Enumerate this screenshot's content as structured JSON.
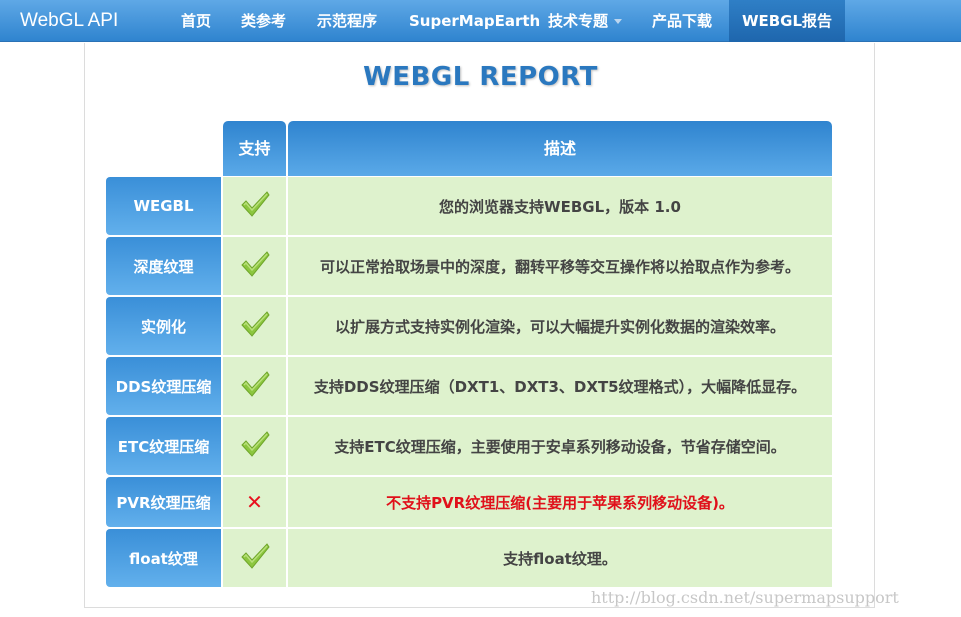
{
  "navbar": {
    "brand": "WebGL API",
    "items": [
      {
        "label": "首页"
      },
      {
        "label": "类参考"
      },
      {
        "label": "示范程序"
      },
      {
        "label": "SuperMapEarth"
      },
      {
        "label": "技术专题"
      },
      {
        "label": "产品下载"
      },
      {
        "label": "WEBGL报告"
      }
    ]
  },
  "title": "WEBGL REPORT",
  "table": {
    "headers": {
      "support": "支持",
      "description": "描述"
    },
    "rows": [
      {
        "feature": "WEGBL",
        "supported": true,
        "description": "您的浏览器支持WEBGL，版本 1.0"
      },
      {
        "feature": "深度纹理",
        "supported": true,
        "description": "可以正常拾取场景中的深度，翻转平移等交互操作将以拾取点作为参考。"
      },
      {
        "feature": "实例化",
        "supported": true,
        "description": "以扩展方式支持实例化渲染，可以大幅提升实例化数据的渲染效率。"
      },
      {
        "feature": "DDS纹理压缩",
        "supported": true,
        "description": "支持DDS纹理压缩（DXT1、DXT3、DXT5纹理格式），大幅降低显存。"
      },
      {
        "feature": "ETC纹理压缩",
        "supported": true,
        "description": "支持ETC纹理压缩，主要使用于安卓系列移动设备，节省存储空间。"
      },
      {
        "feature": "PVR纹理压缩",
        "supported": false,
        "description": "不支持PVR纹理压缩(主要用于苹果系列移动设备)。"
      },
      {
        "feature": "float纹理",
        "supported": true,
        "description": "支持float纹理。"
      }
    ]
  },
  "icons": {
    "supported": "checkmark-icon",
    "unsupported": "cross-icon"
  },
  "colors": {
    "accent": "#2f84cf",
    "cell_bg": "#def2cd",
    "check": "#8cc63f",
    "error": "#e0101a"
  },
  "watermark": "http://blog.csdn.net/supermapsupport"
}
